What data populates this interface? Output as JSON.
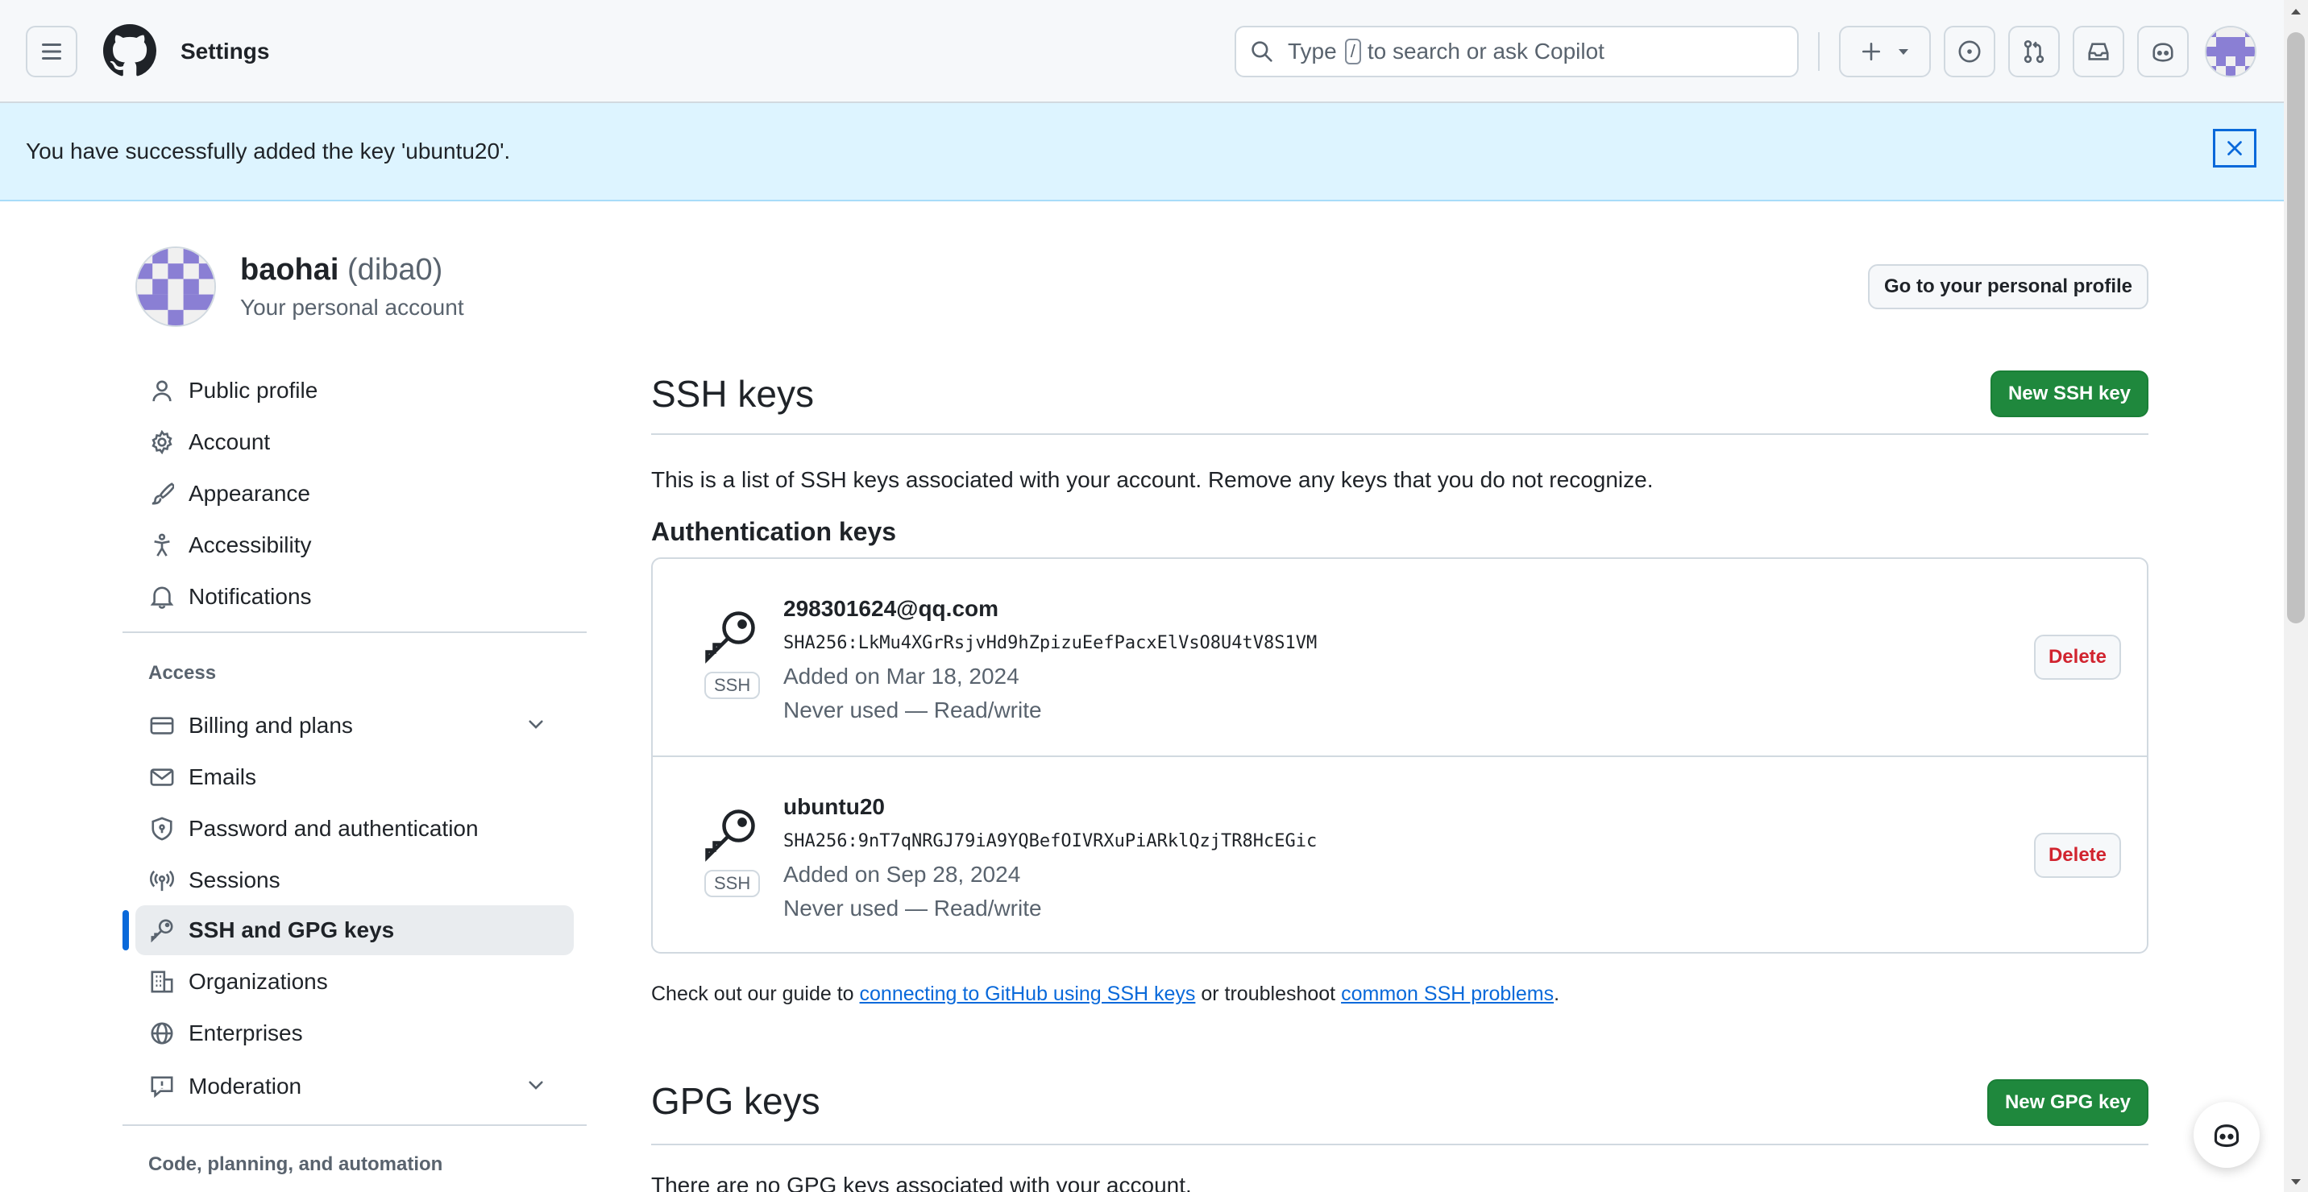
{
  "header": {
    "title": "Settings",
    "search_prefix": "Type",
    "search_key": "/",
    "search_suffix": "to search or ask Copilot"
  },
  "flash": {
    "message": "You have successfully added the key 'ubuntu20'."
  },
  "user": {
    "name": "baohai",
    "login": "(diba0)",
    "subtitle": "Your personal account",
    "profile_button": "Go to your personal profile"
  },
  "sidebar": {
    "items": [
      {
        "label": "Public profile",
        "icon": "person-icon"
      },
      {
        "label": "Account",
        "icon": "gear-icon"
      },
      {
        "label": "Appearance",
        "icon": "paintbrush-icon"
      },
      {
        "label": "Accessibility",
        "icon": "accessibility-icon"
      },
      {
        "label": "Notifications",
        "icon": "bell-icon"
      }
    ],
    "access_heading": "Access",
    "access_items": [
      {
        "label": "Billing and plans",
        "icon": "credit-card-icon",
        "expandable": true
      },
      {
        "label": "Emails",
        "icon": "mail-icon"
      },
      {
        "label": "Password and authentication",
        "icon": "shield-icon"
      },
      {
        "label": "Sessions",
        "icon": "broadcast-icon"
      },
      {
        "label": "SSH and GPG keys",
        "icon": "key-icon",
        "active": true
      },
      {
        "label": "Organizations",
        "icon": "organization-icon"
      },
      {
        "label": "Enterprises",
        "icon": "globe-icon"
      },
      {
        "label": "Moderation",
        "icon": "report-icon",
        "expandable": true
      }
    ],
    "code_heading": "Code, planning, and automation"
  },
  "ssh": {
    "title": "SSH keys",
    "new_button": "New SSH key",
    "description": "This is a list of SSH keys associated with your account. Remove any keys that you do not recognize.",
    "auth_heading": "Authentication keys",
    "keys": [
      {
        "title": "298301624@qq.com",
        "fingerprint": "SHA256:LkMu4XGrRsjvHd9hZpizuEefPacxElVsO8U4tV8S1VM",
        "added": "Added on Mar 18, 2024",
        "usage": "Never used — Read/write",
        "badge": "SSH",
        "delete_label": "Delete"
      },
      {
        "title": "ubuntu20",
        "fingerprint": "SHA256:9nT7qNRGJ79iA9YQBefOIVRXuPiARklQzjTR8HcEGic",
        "added": "Added on Sep 28, 2024",
        "usage": "Never used — Read/write",
        "badge": "SSH",
        "delete_label": "Delete"
      }
    ],
    "guide_prefix": "Check out our guide to",
    "guide_link1": "connecting to GitHub using SSH keys",
    "guide_middle": "or troubleshoot",
    "guide_link2": "common SSH problems",
    "guide_suffix": "."
  },
  "gpg": {
    "title": "GPG keys",
    "new_button": "New GPG key",
    "description": "There are no GPG keys associated with your account."
  },
  "colors": {
    "accent": "#0969da",
    "primary_button": "#1f883d",
    "danger": "#d1242f",
    "flash_bg": "#ddf4ff"
  }
}
